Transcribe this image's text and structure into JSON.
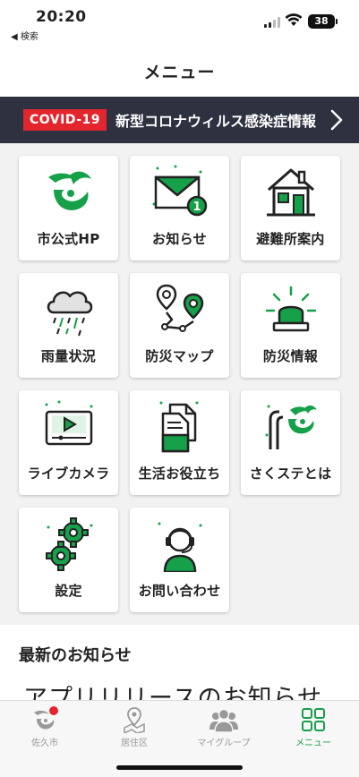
{
  "status_bar": {
    "time": "20:20",
    "back_label": "◀ 検索",
    "battery": "38"
  },
  "header": {
    "title": "メニュー"
  },
  "covid_banner": {
    "badge": "COVID-19",
    "label": "新型コロナウィルス感染症情報"
  },
  "menu": {
    "items": [
      {
        "label": "市公式HP",
        "icon": "city-logo-icon"
      },
      {
        "label": "お知らせ",
        "icon": "mail-notification-icon"
      },
      {
        "label": "避難所案内",
        "icon": "house-icon"
      },
      {
        "label": "雨量状況",
        "icon": "rain-cloud-icon"
      },
      {
        "label": "防災マップ",
        "icon": "map-pin-route-icon"
      },
      {
        "label": "防災情報",
        "icon": "alert-light-icon"
      },
      {
        "label": "ライブカメラ",
        "icon": "video-player-icon"
      },
      {
        "label": "生活お役立ち",
        "icon": "documents-icon"
      },
      {
        "label": "さくステとは",
        "icon": "sakusute-logo-icon"
      },
      {
        "label": "設定",
        "icon": "gears-icon"
      },
      {
        "label": "お問い合わせ",
        "icon": "operator-headset-icon"
      }
    ],
    "notification_count": "1"
  },
  "news": {
    "heading": "最新のお知らせ",
    "first_item": "アプリリリースのお知らせ"
  },
  "tab_bar": {
    "tabs": [
      {
        "label": "佐久市",
        "icon": "city-logo-icon"
      },
      {
        "label": "居住区",
        "icon": "map-pin-icon"
      },
      {
        "label": "マイグループ",
        "icon": "group-icon"
      },
      {
        "label": "メニュー",
        "icon": "grid-menu-icon"
      }
    ],
    "active": "メニュー"
  },
  "colors": {
    "accent_green": "#17a04a",
    "banner_dark": "#2d3140",
    "badge_red": "#e3262e"
  }
}
